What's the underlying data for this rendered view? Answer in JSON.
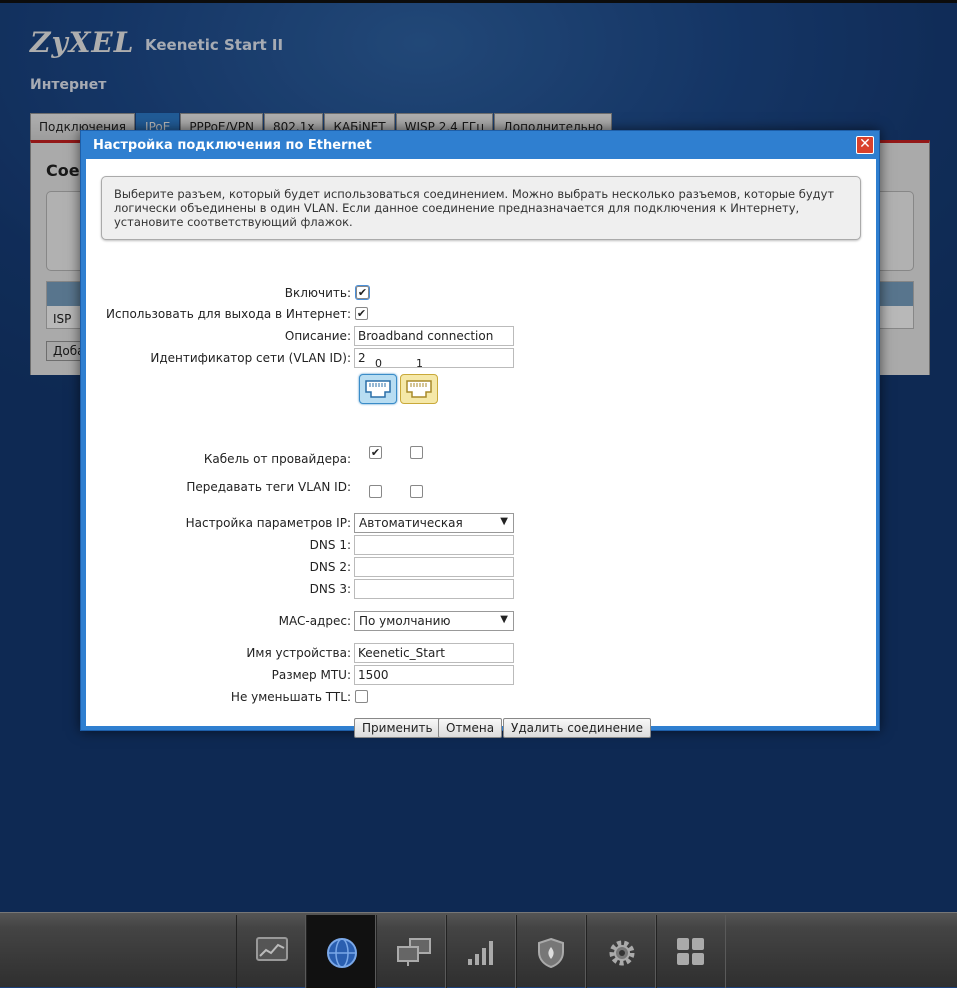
{
  "header": {
    "logo": "ZyXEL",
    "model": "Keenetic Start II",
    "page_title": "Интернет"
  },
  "tabs": [
    {
      "label": "Подключения"
    },
    {
      "label": "IPoE"
    },
    {
      "label": "PPPoE/VPN"
    },
    {
      "label": "802.1x"
    },
    {
      "label": "КАБiNET"
    },
    {
      "label": "WISP 2,4 ГГц"
    },
    {
      "label": "Дополнительно"
    }
  ],
  "background_panel": {
    "title_fragment": "Сое",
    "table_row": "ISP",
    "button_fragment": "Доба"
  },
  "dialog": {
    "title": "Настройка подключения по Ethernet",
    "close_symbol": "✕",
    "info_text": "Выберите разъем, который будет использоваться соединением. Можно выбрать несколько разъемов, которые будут логически объединены в один VLAN. Если данное соединение предназначается для подключения к Интернету, установите соответствующий флажок.",
    "labels": {
      "enable": "Включить:",
      "use_for_internet": "Использовать для выхода в Интернет:",
      "description": "Описание:",
      "vlan_id": "Идентификатор сети (VLAN ID):",
      "isp_cable": "Кабель от провайдера:",
      "vlan_tags": "Передавать теги VLAN ID:",
      "ip_settings": "Настройка параметров IP:",
      "dns1": "DNS 1:",
      "dns2": "DNS 2:",
      "dns3": "DNS 3:",
      "mac": "MAC-адрес:",
      "device_name": "Имя устройства:",
      "mtu": "Размер MTU:",
      "no_ttl_decrement": "Не уменьшать TTL:"
    },
    "values": {
      "enable": true,
      "use_for_internet": true,
      "description": "Broadband connection",
      "vlan_id": "2",
      "ip_settings": "Автоматическая",
      "dns1": "",
      "dns2": "",
      "dns3": "",
      "mac": "По умолчанию",
      "device_name": "Keenetic_Start",
      "mtu": "1500",
      "no_ttl_decrement": false
    },
    "ports": [
      {
        "number": "0",
        "isp_cable": true,
        "vlan_tags": false
      },
      {
        "number": "1",
        "isp_cable": false,
        "vlan_tags": false
      }
    ],
    "buttons": {
      "apply": "Применить",
      "cancel": "Отмена",
      "delete": "Удалить соединение"
    }
  },
  "taskbar": [
    {
      "icon": "monitor-chart-icon"
    },
    {
      "icon": "globe-icon"
    },
    {
      "icon": "network-computers-icon"
    },
    {
      "icon": "signal-bars-icon"
    },
    {
      "icon": "shield-icon"
    },
    {
      "icon": "gear-icon"
    },
    {
      "icon": "apps-grid-icon"
    }
  ],
  "colors": {
    "dialog_blue": "#2f7fd0",
    "active_tab": "#2f7fd0",
    "close_red": "#d9412c",
    "port0": "#b8ddf2",
    "port1": "#f5e8a8"
  }
}
